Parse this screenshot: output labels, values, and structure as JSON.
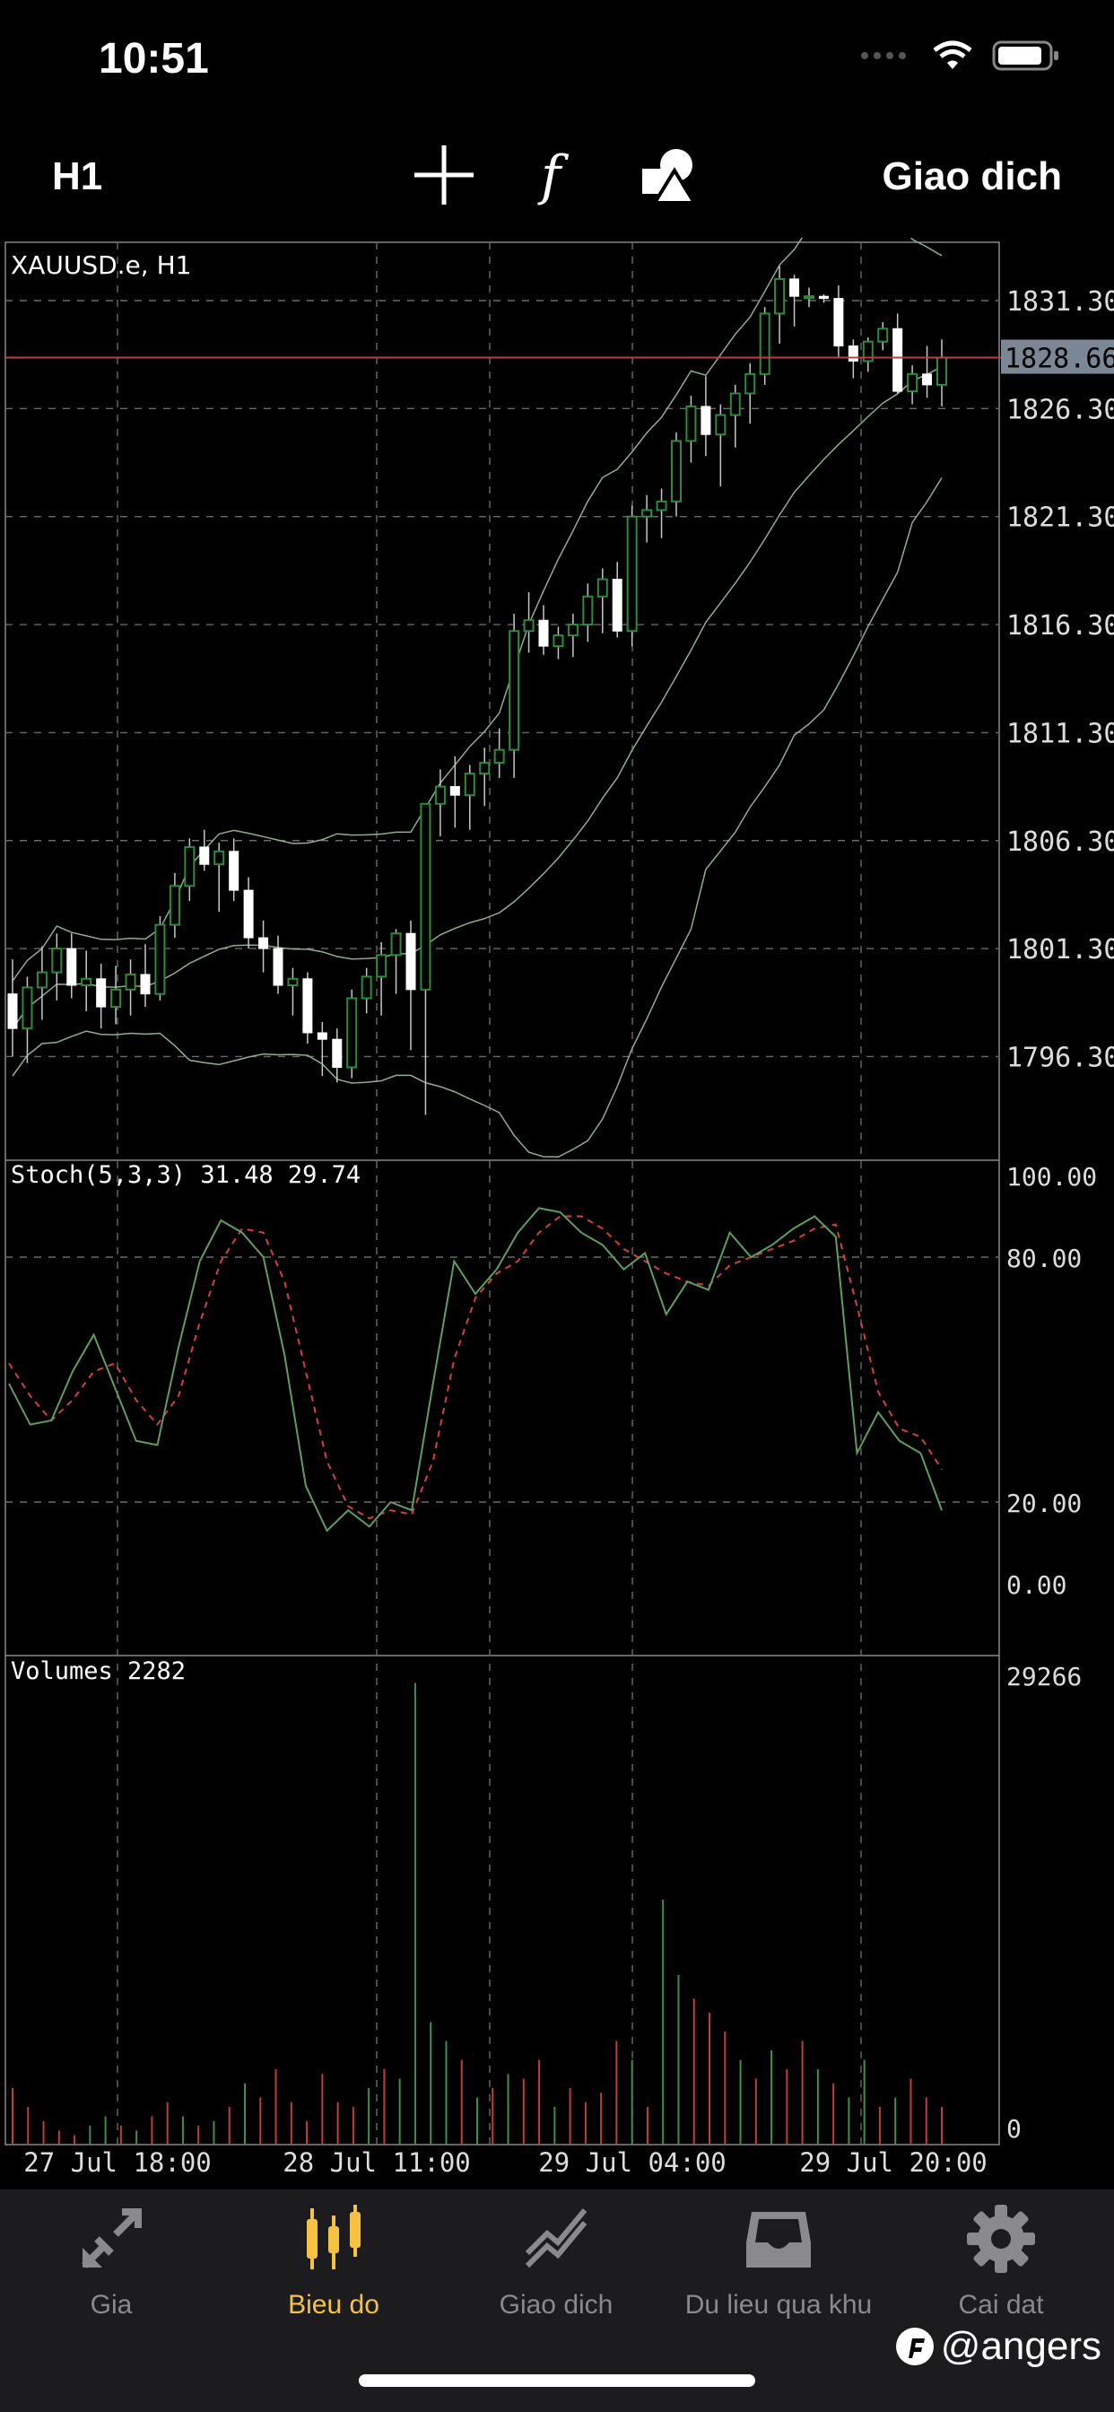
{
  "status_bar": {
    "time": "10:51"
  },
  "toolbar": {
    "timeframe": "H1",
    "trade_label": "Giao dich"
  },
  "chart_header": {
    "symbol_label": "XAUUSD.e, H1",
    "stoch_label": "Stoch(5,3,3) 31.48 29.74",
    "volumes_label": "Volumes 2282"
  },
  "current_price": "1828.66",
  "colors": {
    "bull": "#ffffff",
    "grid": "#6a6a6a",
    "stoch_main": "#5f9e5f",
    "stoch_signal": "#d44040",
    "vol_up": "#3f8e4a",
    "vol_down": "#c23c3c",
    "accent": "#f5c242"
  },
  "tabs": [
    {
      "label": "Gia",
      "icon": "arrows-icon"
    },
    {
      "label": "Bieu do",
      "icon": "candlestick-icon"
    },
    {
      "label": "Giao dich",
      "icon": "trend-icon"
    },
    {
      "label": "Du lieu qua khu",
      "icon": "inbox-icon"
    },
    {
      "label": "Cai dat",
      "icon": "gear-icon"
    }
  ],
  "watermark": "@angers",
  "chart_data": [
    {
      "type": "candlestick",
      "title": "XAUUSD.e, H1",
      "y_ticks": [
        "1831.30",
        "1826.30",
        "1821.30",
        "1816.30",
        "1811.30",
        "1806.30",
        "1801.30",
        "1796.30"
      ],
      "ylim": [
        1791.5,
        1834
      ],
      "x_ticks": [
        "27 Jul 18:00",
        "28 Jul 11:00",
        "29 Jul 04:00",
        "29 Jul 20:00"
      ],
      "current_price": 1828.66,
      "ohlc": [
        [
          1799.2,
          1800.8,
          1796.3,
          1797.6
        ],
        [
          1797.6,
          1800.0,
          1796.0,
          1799.5
        ],
        [
          1799.5,
          1801.4,
          1798.0,
          1800.2
        ],
        [
          1800.2,
          1802.0,
          1798.9,
          1801.3
        ],
        [
          1801.3,
          1802.0,
          1799.0,
          1799.6
        ],
        [
          1799.6,
          1801.2,
          1798.4,
          1799.9
        ],
        [
          1799.9,
          1800.6,
          1797.6,
          1798.6
        ],
        [
          1798.6,
          1800.5,
          1797.8,
          1799.4
        ],
        [
          1799.4,
          1800.8,
          1798.2,
          1800.1
        ],
        [
          1800.1,
          1801.5,
          1798.6,
          1799.2
        ],
        [
          1799.2,
          1802.8,
          1798.9,
          1802.4
        ],
        [
          1802.4,
          1804.8,
          1801.8,
          1804.2
        ],
        [
          1804.2,
          1806.4,
          1803.5,
          1806.0
        ],
        [
          1806.0,
          1806.8,
          1804.9,
          1805.2
        ],
        [
          1805.2,
          1806.2,
          1803.0,
          1805.8
        ],
        [
          1805.8,
          1806.4,
          1803.5,
          1804.0
        ],
        [
          1804.0,
          1804.6,
          1801.3,
          1801.8
        ],
        [
          1801.8,
          1802.6,
          1800.2,
          1801.3
        ],
        [
          1801.3,
          1801.9,
          1799.2,
          1799.6
        ],
        [
          1799.6,
          1800.4,
          1798.2,
          1799.9
        ],
        [
          1799.9,
          1800.2,
          1796.9,
          1797.4
        ],
        [
          1797.4,
          1797.9,
          1795.4,
          1797.1
        ],
        [
          1797.1,
          1797.6,
          1795.1,
          1795.8
        ],
        [
          1795.8,
          1799.4,
          1795.3,
          1799.0
        ],
        [
          1799.0,
          1800.4,
          1798.3,
          1800.0
        ],
        [
          1800.0,
          1801.6,
          1798.2,
          1801.0
        ],
        [
          1801.0,
          1802.2,
          1799.2,
          1802.0
        ],
        [
          1802.0,
          1802.6,
          1796.6,
          1799.4
        ],
        [
          1799.4,
          1807.6,
          1793.6,
          1808.0
        ],
        [
          1808.0,
          1809.6,
          1806.5,
          1808.8
        ],
        [
          1808.8,
          1810.2,
          1806.9,
          1808.4
        ],
        [
          1808.4,
          1809.8,
          1806.8,
          1809.4
        ],
        [
          1809.4,
          1810.6,
          1807.9,
          1809.9
        ],
        [
          1809.9,
          1811.5,
          1809.2,
          1810.5
        ],
        [
          1810.5,
          1816.8,
          1809.2,
          1816.0
        ],
        [
          1816.0,
          1817.8,
          1815.0,
          1816.5
        ],
        [
          1816.5,
          1817.2,
          1814.9,
          1815.3
        ],
        [
          1815.3,
          1816.2,
          1814.7,
          1815.8
        ],
        [
          1815.8,
          1816.8,
          1814.8,
          1816.3
        ],
        [
          1816.3,
          1818.2,
          1815.5,
          1817.6
        ],
        [
          1817.6,
          1818.9,
          1815.9,
          1818.4
        ],
        [
          1818.4,
          1819.2,
          1815.7,
          1816.0
        ],
        [
          1816.0,
          1821.8,
          1815.3,
          1821.3
        ],
        [
          1821.3,
          1822.3,
          1820.1,
          1821.6
        ],
        [
          1821.6,
          1822.6,
          1820.3,
          1822.0
        ],
        [
          1822.0,
          1825.2,
          1821.3,
          1824.8
        ],
        [
          1824.8,
          1826.9,
          1823.8,
          1826.4
        ],
        [
          1826.4,
          1827.8,
          1824.1,
          1825.1
        ],
        [
          1825.1,
          1826.5,
          1822.7,
          1826.0
        ],
        [
          1826.0,
          1827.4,
          1824.5,
          1827.0
        ],
        [
          1827.0,
          1828.4,
          1825.6,
          1827.9
        ],
        [
          1827.9,
          1831.0,
          1827.4,
          1830.7
        ],
        [
          1830.7,
          1832.9,
          1829.3,
          1832.3
        ],
        [
          1832.3,
          1832.5,
          1830.1,
          1831.5
        ],
        [
          1831.5,
          1831.9,
          1831.0,
          1831.5
        ],
        [
          1831.5,
          1831.6,
          1831.2,
          1831.4
        ],
        [
          1831.4,
          1832.0,
          1828.7,
          1829.2
        ],
        [
          1829.2,
          1829.5,
          1827.7,
          1828.5
        ],
        [
          1828.5,
          1829.6,
          1828.0,
          1829.4
        ],
        [
          1829.4,
          1830.3,
          1829.0,
          1830.0
        ],
        [
          1830.0,
          1830.7,
          1827.0,
          1827.1
        ],
        [
          1827.1,
          1828.3,
          1826.5,
          1827.9
        ],
        [
          1827.9,
          1829.2,
          1826.8,
          1827.4
        ],
        [
          1827.4,
          1829.5,
          1826.4,
          1828.66
        ]
      ]
    },
    {
      "type": "line",
      "title": "Stoch(5,3,3) 31.48 29.74",
      "y_ticks": [
        "100.00",
        "80.00",
        "20.00",
        "0.00"
      ],
      "ylim": [
        0,
        100
      ],
      "series": [
        {
          "values": [
            49,
            39,
            40,
            52,
            61,
            48,
            35,
            34,
            58,
            79,
            89,
            86,
            80,
            56,
            24,
            13,
            18,
            14,
            20,
            18,
            49,
            79,
            71,
            77,
            86,
            92,
            91,
            86,
            83,
            77,
            81,
            66,
            74,
            72,
            86,
            80,
            83,
            87,
            90,
            85,
            32,
            42,
            35,
            32,
            18
          ]
        },
        {
          "values": [
            54,
            46,
            40,
            45,
            52,
            54,
            45,
            39,
            46,
            64,
            79,
            87,
            86,
            74,
            52,
            30,
            19,
            16,
            18,
            17,
            30,
            55,
            70,
            76,
            79,
            86,
            90,
            90,
            87,
            82,
            79,
            76,
            74,
            73,
            78,
            80,
            82,
            84,
            87,
            88,
            68,
            47,
            38,
            36,
            28
          ]
        }
      ]
    },
    {
      "type": "bar",
      "title": "Volumes 2282",
      "y_ticks": [
        "29266",
        "0"
      ],
      "ylim": [
        0,
        29266
      ],
      "values": [
        12,
        8,
        5,
        3,
        2,
        4,
        6,
        4,
        3,
        6,
        9,
        6,
        4,
        5,
        8,
        13,
        10,
        16,
        9,
        5,
        15,
        9,
        8,
        12,
        16,
        14,
        98,
        26,
        22,
        18,
        10,
        12,
        15,
        14,
        18,
        8,
        12,
        9,
        11,
        22,
        18,
        8,
        52,
        36,
        31,
        28,
        24,
        18,
        14,
        20,
        16,
        22,
        16,
        13,
        10,
        18,
        8,
        10,
        14,
        10,
        8
      ],
      "bar_colors": [
        "r",
        "r",
        "r",
        "r",
        "r",
        "g",
        "g",
        "r",
        "g",
        "r",
        "r",
        "g",
        "r",
        "g",
        "r",
        "g",
        "r",
        "r",
        "r",
        "r",
        "r",
        "r",
        "r",
        "g",
        "r",
        "g",
        "g",
        "g",
        "g",
        "r",
        "g",
        "r",
        "g",
        "r",
        "r",
        "g",
        "r",
        "r",
        "r",
        "r",
        "g",
        "r",
        "g",
        "g",
        "r",
        "r",
        "r",
        "g",
        "r",
        "g",
        "r",
        "r",
        "g",
        "r",
        "g",
        "g",
        "r",
        "g",
        "r",
        "r",
        "r"
      ]
    }
  ]
}
